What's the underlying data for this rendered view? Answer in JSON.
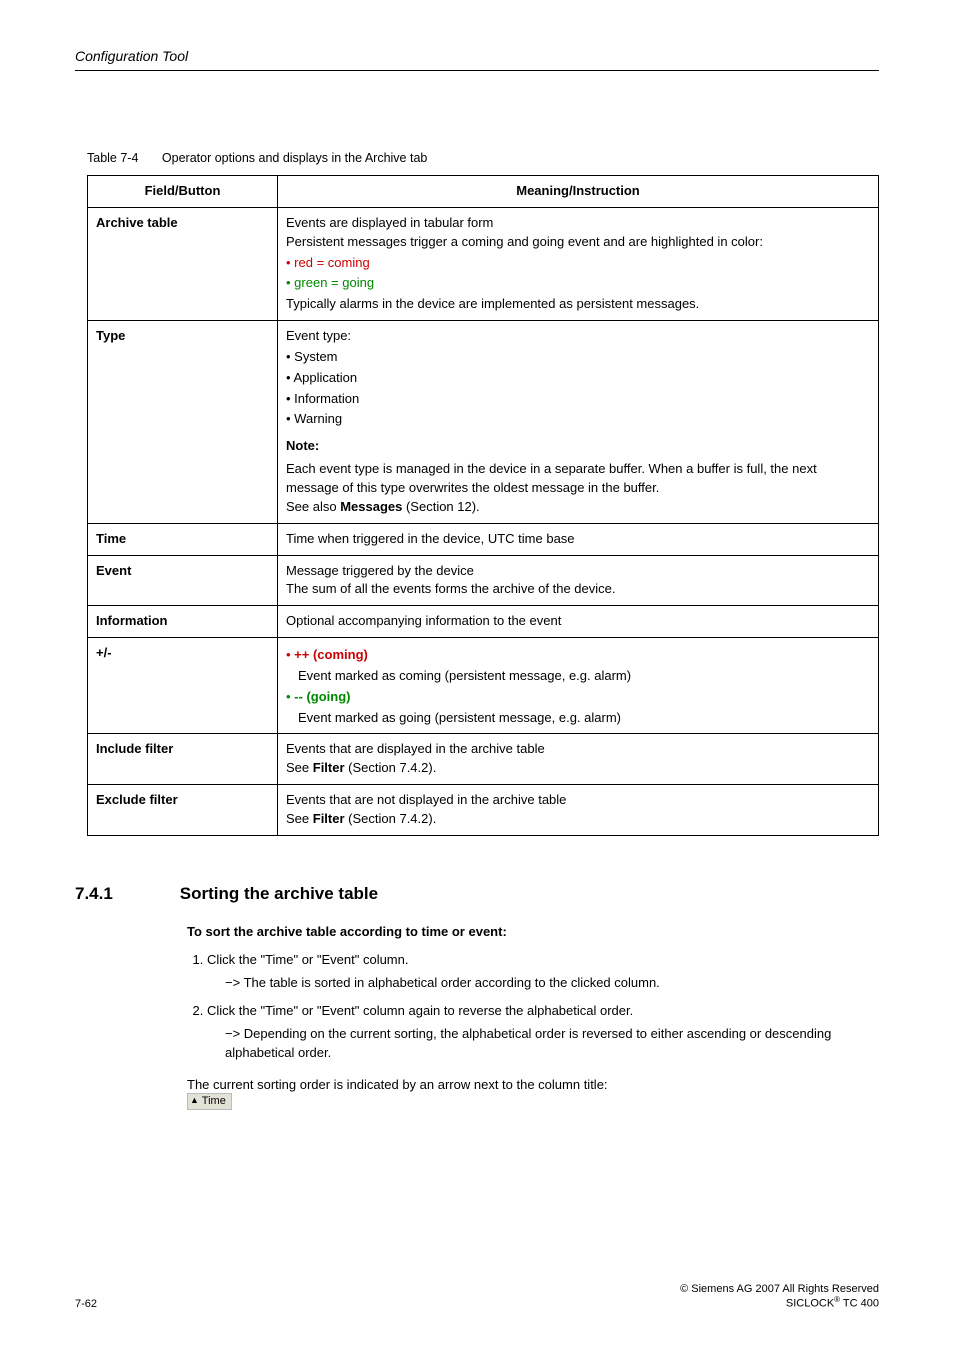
{
  "running_head": "Configuration Tool",
  "table_caption": {
    "num": "Table 7-4",
    "text": "Operator options and displays in the Archive tab"
  },
  "headers": {
    "field": "Field/Button",
    "meaning": "Meaning/Instruction"
  },
  "rows": {
    "archive_table": {
      "field": "Archive table",
      "line1": "Events are displayed in tabular form",
      "line2": "Persistent messages trigger a coming and going event and are highlighted in color:",
      "b1": "red = coming",
      "b2": "green = going",
      "line3": "Typically alarms in the device are implemented as persistent messages."
    },
    "type": {
      "field": "Type",
      "lead": "Event type:",
      "b1": "System",
      "b2": "Application",
      "b3": "Information",
      "b4": "Warning",
      "note_label": "Note:",
      "note_text": "Each event type is managed in the device in a separate buffer. When a buffer is full, the next message of this type overwrites the oldest message in the buffer.",
      "see_pref": "See also ",
      "see_bold": "Messages",
      "see_suf": " (Section 12)."
    },
    "time": {
      "field": "Time",
      "text": "Time when triggered in the device, UTC time base"
    },
    "event": {
      "field": "Event",
      "l1": "Message triggered by the device",
      "l2": "The sum of all the events forms the archive of the device."
    },
    "information": {
      "field": "Information",
      "text": "Optional accompanying information to the event"
    },
    "pm": {
      "field": "+/-",
      "b1": "++ (coming)",
      "b1d": "Event marked as coming (persistent message, e.g. alarm)",
      "b2": "-- (going)",
      "b2d": "Event marked as going (persistent message, e.g. alarm)"
    },
    "include": {
      "field": "Include filter",
      "l1": "Events that are displayed in the archive table",
      "see_pref": "See ",
      "see_bold": "Filter",
      "see_suf": " (Section 7.4.2)."
    },
    "exclude": {
      "field": "Exclude filter",
      "l1": "Events that are not displayed in the archive table",
      "see_pref": "See ",
      "see_bold": "Filter",
      "see_suf": " (Section 7.4.2)."
    }
  },
  "section": {
    "num": "7.4.1",
    "title": "Sorting the archive table"
  },
  "procedure": {
    "title": "To sort the archive table according to time or event:",
    "step1": "Click the \"Time\" or \"Event\" column.",
    "result1": "The table is sorted in alphabetical order according to the clicked column.",
    "step2": "Click the \"Time\" or \"Event\" column again to reverse the alphabetical order.",
    "result2": "Depending on the current sorting, the alphabetical order is reversed to either ascending or descending alphabetical order.",
    "closing": "The current sorting order is indicated by an arrow next to the column title:",
    "chip": "Time"
  },
  "footer": {
    "pagenum": "7-62",
    "copyright": "Siemens AG 2007 All Rights Reserved",
    "product_a": "SICLOCK",
    "product_b": " TC 400"
  }
}
